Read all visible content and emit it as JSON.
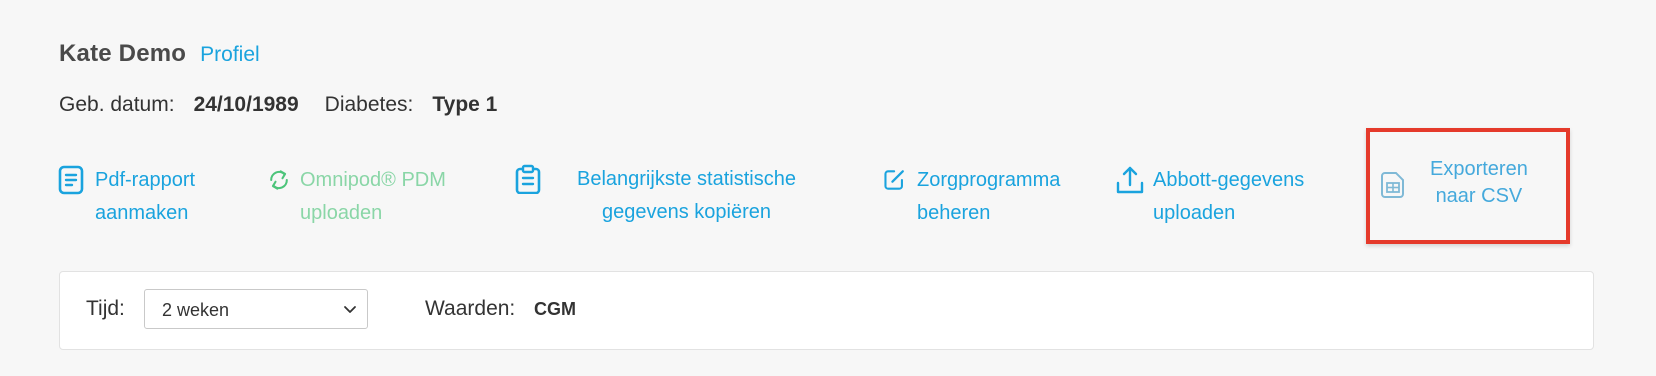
{
  "patient": {
    "name": "Kate Demo",
    "profile_link": "Profiel",
    "dob_label": "Geb. datum:",
    "dob_value": "24/10/1989",
    "diabetes_label": "Diabetes:",
    "diabetes_value": "Type 1"
  },
  "actions": {
    "pdf_report": {
      "line1": "Pdf-rapport",
      "line2": "aanmaken",
      "icon": "document-icon"
    },
    "omnipod_upload": {
      "line1": "Omnipod® PDM",
      "line2": "uploaden",
      "icon": "sync-icon",
      "disabled": true
    },
    "copy_stats": {
      "line1": "Belangrijkste statistische",
      "line2": "gegevens kopiëren",
      "icon": "clipboard-icon"
    },
    "care_program": {
      "line1": "Zorgprogramma",
      "line2": "beheren",
      "icon": "edit-icon"
    },
    "abbott_upload": {
      "line1": "Abbott-gegevens",
      "line2": "uploaden",
      "icon": "upload-icon"
    },
    "export_csv": {
      "line1": "Exporteren",
      "line2": "naar CSV",
      "icon": "csv-file-icon"
    }
  },
  "filters": {
    "time_label": "Tijd:",
    "time_value": "2 weken",
    "values_label": "Waarden:",
    "values_value": "CGM"
  },
  "colors": {
    "accent": "#1aa3de",
    "disabled_green": "#8ad6a7",
    "highlight_red": "#e53a2b",
    "background": "#f7f7f7"
  }
}
